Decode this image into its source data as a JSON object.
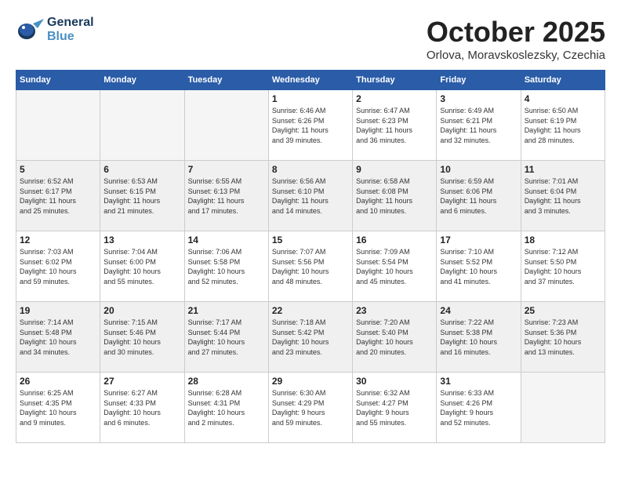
{
  "header": {
    "logo_line1": "General",
    "logo_line2": "Blue",
    "month": "October 2025",
    "location": "Orlova, Moravskoslezsky, Czechia"
  },
  "days_of_week": [
    "Sunday",
    "Monday",
    "Tuesday",
    "Wednesday",
    "Thursday",
    "Friday",
    "Saturday"
  ],
  "weeks": [
    [
      {
        "day": "",
        "info": ""
      },
      {
        "day": "",
        "info": ""
      },
      {
        "day": "",
        "info": ""
      },
      {
        "day": "1",
        "info": "Sunrise: 6:46 AM\nSunset: 6:26 PM\nDaylight: 11 hours\nand 39 minutes."
      },
      {
        "day": "2",
        "info": "Sunrise: 6:47 AM\nSunset: 6:23 PM\nDaylight: 11 hours\nand 36 minutes."
      },
      {
        "day": "3",
        "info": "Sunrise: 6:49 AM\nSunset: 6:21 PM\nDaylight: 11 hours\nand 32 minutes."
      },
      {
        "day": "4",
        "info": "Sunrise: 6:50 AM\nSunset: 6:19 PM\nDaylight: 11 hours\nand 28 minutes."
      }
    ],
    [
      {
        "day": "5",
        "info": "Sunrise: 6:52 AM\nSunset: 6:17 PM\nDaylight: 11 hours\nand 25 minutes."
      },
      {
        "day": "6",
        "info": "Sunrise: 6:53 AM\nSunset: 6:15 PM\nDaylight: 11 hours\nand 21 minutes."
      },
      {
        "day": "7",
        "info": "Sunrise: 6:55 AM\nSunset: 6:13 PM\nDaylight: 11 hours\nand 17 minutes."
      },
      {
        "day": "8",
        "info": "Sunrise: 6:56 AM\nSunset: 6:10 PM\nDaylight: 11 hours\nand 14 minutes."
      },
      {
        "day": "9",
        "info": "Sunrise: 6:58 AM\nSunset: 6:08 PM\nDaylight: 11 hours\nand 10 minutes."
      },
      {
        "day": "10",
        "info": "Sunrise: 6:59 AM\nSunset: 6:06 PM\nDaylight: 11 hours\nand 6 minutes."
      },
      {
        "day": "11",
        "info": "Sunrise: 7:01 AM\nSunset: 6:04 PM\nDaylight: 11 hours\nand 3 minutes."
      }
    ],
    [
      {
        "day": "12",
        "info": "Sunrise: 7:03 AM\nSunset: 6:02 PM\nDaylight: 10 hours\nand 59 minutes."
      },
      {
        "day": "13",
        "info": "Sunrise: 7:04 AM\nSunset: 6:00 PM\nDaylight: 10 hours\nand 55 minutes."
      },
      {
        "day": "14",
        "info": "Sunrise: 7:06 AM\nSunset: 5:58 PM\nDaylight: 10 hours\nand 52 minutes."
      },
      {
        "day": "15",
        "info": "Sunrise: 7:07 AM\nSunset: 5:56 PM\nDaylight: 10 hours\nand 48 minutes."
      },
      {
        "day": "16",
        "info": "Sunrise: 7:09 AM\nSunset: 5:54 PM\nDaylight: 10 hours\nand 45 minutes."
      },
      {
        "day": "17",
        "info": "Sunrise: 7:10 AM\nSunset: 5:52 PM\nDaylight: 10 hours\nand 41 minutes."
      },
      {
        "day": "18",
        "info": "Sunrise: 7:12 AM\nSunset: 5:50 PM\nDaylight: 10 hours\nand 37 minutes."
      }
    ],
    [
      {
        "day": "19",
        "info": "Sunrise: 7:14 AM\nSunset: 5:48 PM\nDaylight: 10 hours\nand 34 minutes."
      },
      {
        "day": "20",
        "info": "Sunrise: 7:15 AM\nSunset: 5:46 PM\nDaylight: 10 hours\nand 30 minutes."
      },
      {
        "day": "21",
        "info": "Sunrise: 7:17 AM\nSunset: 5:44 PM\nDaylight: 10 hours\nand 27 minutes."
      },
      {
        "day": "22",
        "info": "Sunrise: 7:18 AM\nSunset: 5:42 PM\nDaylight: 10 hours\nand 23 minutes."
      },
      {
        "day": "23",
        "info": "Sunrise: 7:20 AM\nSunset: 5:40 PM\nDaylight: 10 hours\nand 20 minutes."
      },
      {
        "day": "24",
        "info": "Sunrise: 7:22 AM\nSunset: 5:38 PM\nDaylight: 10 hours\nand 16 minutes."
      },
      {
        "day": "25",
        "info": "Sunrise: 7:23 AM\nSunset: 5:36 PM\nDaylight: 10 hours\nand 13 minutes."
      }
    ],
    [
      {
        "day": "26",
        "info": "Sunrise: 6:25 AM\nSunset: 4:35 PM\nDaylight: 10 hours\nand 9 minutes."
      },
      {
        "day": "27",
        "info": "Sunrise: 6:27 AM\nSunset: 4:33 PM\nDaylight: 10 hours\nand 6 minutes."
      },
      {
        "day": "28",
        "info": "Sunrise: 6:28 AM\nSunset: 4:31 PM\nDaylight: 10 hours\nand 2 minutes."
      },
      {
        "day": "29",
        "info": "Sunrise: 6:30 AM\nSunset: 4:29 PM\nDaylight: 9 hours\nand 59 minutes."
      },
      {
        "day": "30",
        "info": "Sunrise: 6:32 AM\nSunset: 4:27 PM\nDaylight: 9 hours\nand 55 minutes."
      },
      {
        "day": "31",
        "info": "Sunrise: 6:33 AM\nSunset: 4:26 PM\nDaylight: 9 hours\nand 52 minutes."
      },
      {
        "day": "",
        "info": ""
      }
    ]
  ]
}
